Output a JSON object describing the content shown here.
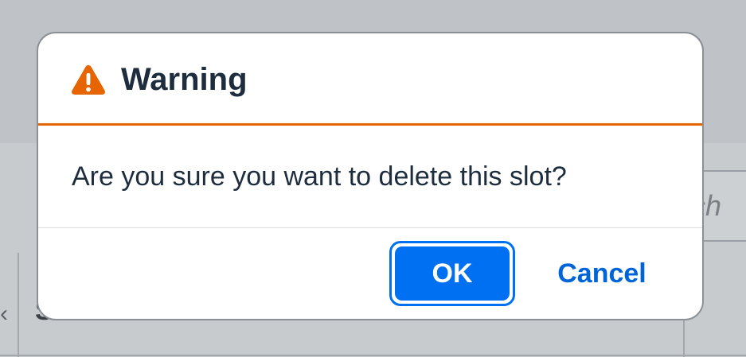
{
  "background": {
    "search_fragment": "ch",
    "left_glyph": "‹",
    "panel_letter": "S"
  },
  "dialog": {
    "title": "Warning",
    "icon": "warning-triangle-icon",
    "message": "Are you sure you want to delete this slot?",
    "ok_label": "OK",
    "cancel_label": "Cancel"
  },
  "colors": {
    "warning_accent": "#e76500",
    "primary_button": "#0070f2",
    "link_text": "#0064d9",
    "title_text": "#1d2d3e"
  }
}
